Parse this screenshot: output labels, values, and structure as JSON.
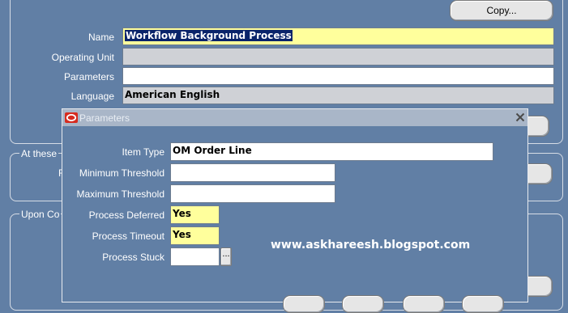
{
  "background_form": {
    "copy_button": "Copy...",
    "fields": [
      {
        "label": "Name",
        "value": "Workflow Background Process"
      },
      {
        "label": "Operating Unit",
        "value": ""
      },
      {
        "label": "Parameters",
        "value": ""
      },
      {
        "label": "Language",
        "value": "American English"
      }
    ],
    "group_at_these": "At these",
    "group_at_these_partial_label": "R",
    "group_upon_completion": "Upon Co"
  },
  "dialog": {
    "title": "Parameters",
    "fields": [
      {
        "label": "Item Type",
        "value": "OM Order Line"
      },
      {
        "label": "Minimum Threshold",
        "value": ""
      },
      {
        "label": "Maximum Threshold",
        "value": ""
      },
      {
        "label": "Process Deferred",
        "value": "Yes"
      },
      {
        "label": "Process Timeout",
        "value": "Yes"
      },
      {
        "label": "Process Stuck",
        "value": ""
      }
    ],
    "lov_button": "..."
  },
  "watermark": "www.askhareesh.blogspot.com",
  "colors": {
    "background": "#617fa5",
    "required_field": "#ffff9c",
    "readonly_field": "#cfd1d6",
    "titlebar": "#a9b6c8",
    "oracle_logo": "#d62b1f"
  },
  "icons": {
    "dialog_logo": "oracle-logo-icon",
    "close": "close-icon"
  }
}
